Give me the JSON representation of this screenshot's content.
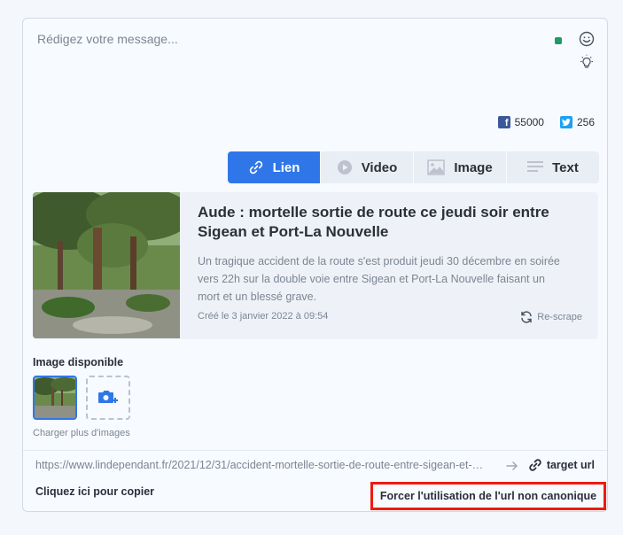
{
  "composer": {
    "placeholder": "Rédigez votre message...",
    "status_color": "#1f9a68"
  },
  "social": {
    "facebook_count": "55000",
    "twitter_count": "256",
    "facebook_color": "#3b5998",
    "twitter_color": "#1da1f2"
  },
  "tabs": [
    {
      "label": "Lien",
      "icon": "link-icon",
      "active": true
    },
    {
      "label": "Video",
      "icon": "play-icon",
      "active": false
    },
    {
      "label": "Image",
      "icon": "image-icon",
      "active": false
    },
    {
      "label": "Text",
      "icon": "text-lines-icon",
      "active": false
    }
  ],
  "accent_color": "#2f77e9",
  "preview": {
    "title": "Aude : mortelle sortie de route ce jeudi soir entre Sigean et Port-La Nouvelle",
    "description": "Un tragique accident de la route s'est produit jeudi 30 décembre en soirée vers 22h sur la double voie entre Sigean et Port-La Nouvelle faisant un mort et un blessé grave.",
    "date": "Créé le 3 janvier 2022 à 09:54",
    "rescrape_label": "Re-scrape"
  },
  "images": {
    "label": "Image disponible",
    "load_more": "Charger plus d'images"
  },
  "url_bar": {
    "url": "https://www.lindependant.fr/2021/12/31/accident-mortelle-sortie-de-route-entre-sigean-et-port-la-nouvelle",
    "target_label": "target url",
    "copy_label": "Cliquez ici pour copier",
    "force_label": "Forcer l'utilisation de l'url non canonique",
    "highlight_color": "#ee1c0e"
  }
}
